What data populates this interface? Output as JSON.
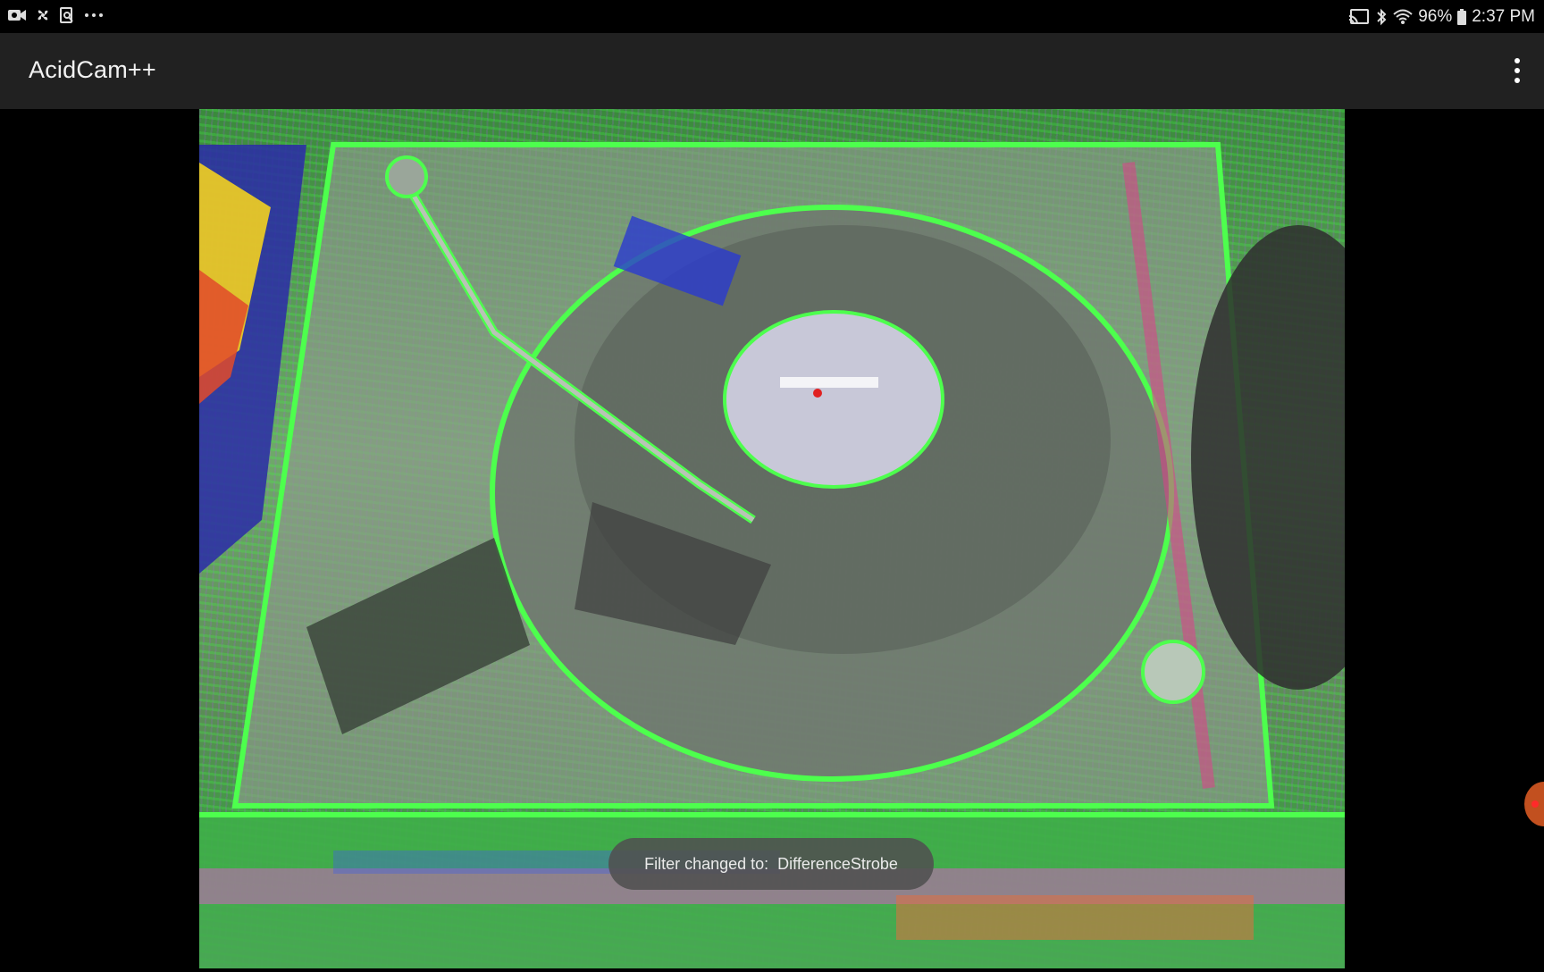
{
  "status_bar": {
    "battery": "96%",
    "time": "2:37 PM",
    "left_icons": [
      "video-camera-icon",
      "pinwheel-icon",
      "screenshot-icon",
      "more-dots-icon"
    ],
    "right_icons": [
      "cast-icon",
      "bluetooth-icon",
      "wifi-icon",
      "battery-icon"
    ]
  },
  "app_bar": {
    "title": "AcidCam++",
    "menu_icon": "overflow-menu-icon"
  },
  "toast": {
    "message": "Filter changed to:  DifferenceStrobe"
  },
  "colors": {
    "status_bar_bg": "#000000",
    "app_bar_bg": "#212121",
    "preview_dominant": "#3cff3c",
    "toast_bg": "#505050",
    "edge_handle": "#c2501f"
  }
}
